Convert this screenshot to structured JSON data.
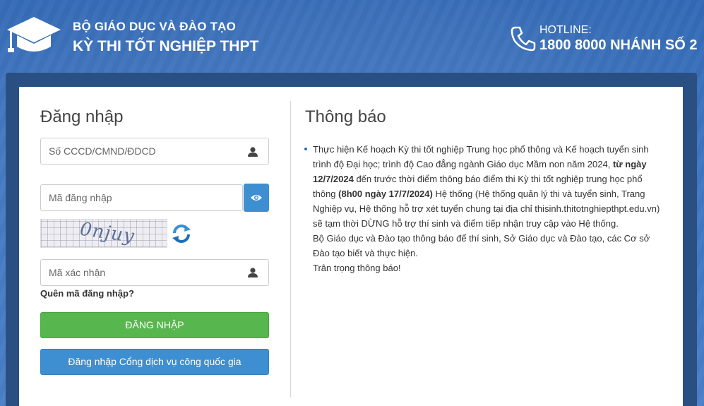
{
  "header": {
    "org_name": "BỘ GIÁO DỤC VÀ ĐÀO TẠO",
    "exam_name": "KỲ THI TỐT NGHIỆP THPT",
    "hotline_label": "HOTLINE:",
    "hotline_number": "1800 8000 NHÁNH SỐ 2",
    "logo_icon": "graduation-cap-icon",
    "phone_icon": "phone-icon"
  },
  "login": {
    "title": "Đăng nhập",
    "id_placeholder": "Số CCCD/CMND/ĐDCD",
    "password_placeholder": "Mã đăng nhập",
    "captcha_text": "0njuy",
    "captcha_input_placeholder": "Mã xác nhận",
    "forgot_label": "Quên mã đăng nhập?",
    "login_button": "ĐĂNG NHẬP",
    "portal_button": "Đăng nhập Cổng dịch vụ công quốc gia"
  },
  "notice": {
    "title": "Thông báo",
    "p1_a": "Thực hiện Kế hoạch Kỳ thi tốt nghiệp Trung học phổ thông và Kế hoạch tuyển sinh trình độ Đại học; trình độ Cao đẳng ngành Giáo dục Mầm non năm 2024, ",
    "p1_b": "từ ngày 12/7/2024",
    "p1_c": " đến trước thời điểm thông báo điểm thi Kỳ thi tốt nghiệp trung học phổ thông ",
    "p1_d": "(8h00 ngày 17/7/2024)",
    "p1_e": " Hệ thống (Hệ thống quản lý thi và tuyển sinh, Trang Nghiệp vụ, Hệ thống hỗ trợ xét tuyển chung tại địa chỉ thisinh.thitotnghiepthpt.edu.vn) sẽ tạm thời DỪNG hỗ trợ thí sinh và điểm tiếp nhận truy cập vào Hệ thống.",
    "p2": "Bộ Giáo dục và Đào tạo thông báo để thí sinh, Sở Giáo dục và Đào tạo, các Cơ sở Đào tạo biết và thực hiện.",
    "p3": "Trân trọng thông báo!"
  },
  "colors": {
    "header_bg": "#3b74c0",
    "panel_dark": "#2a4f82",
    "login_green": "#58b64f",
    "portal_blue": "#3d8fd1"
  }
}
